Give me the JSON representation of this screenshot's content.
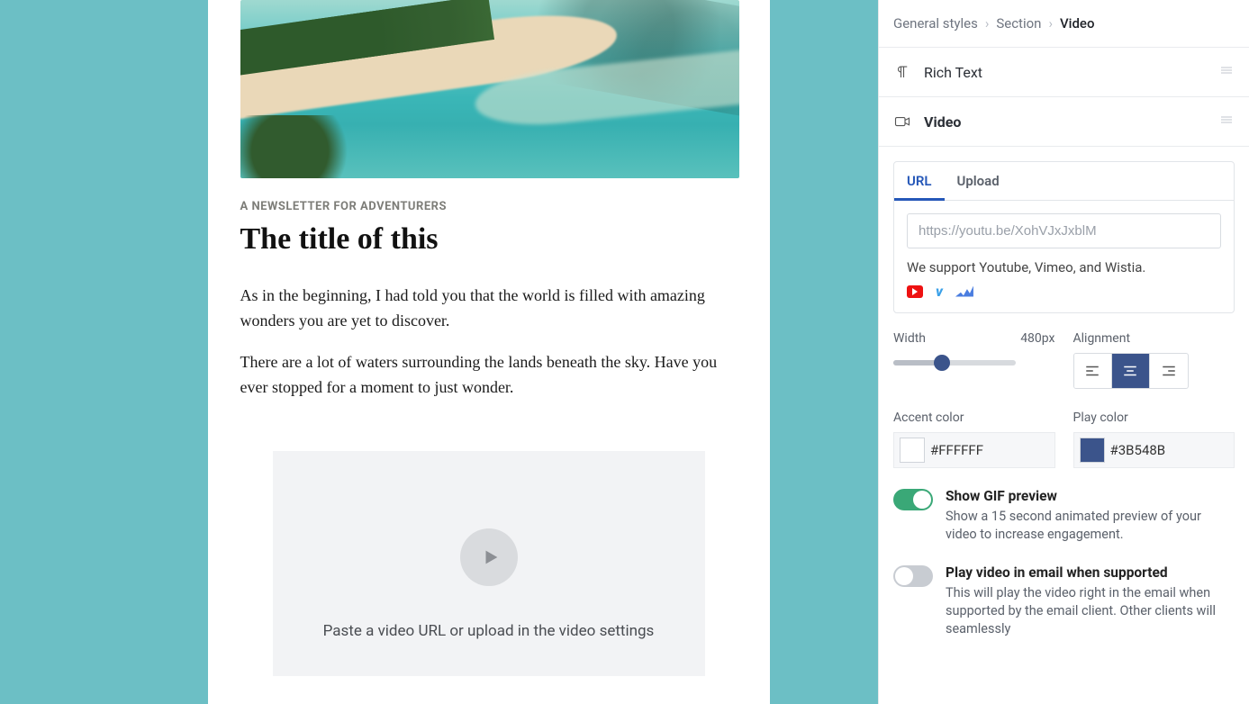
{
  "preview": {
    "kicker": "A NEWSLETTER FOR ADVENTURERS",
    "title": "The title of this",
    "paragraphs": [
      "As in the beginning, I had told you that the world is filled with amazing wonders you are yet to discover.",
      "There are a lot of waters surrounding the lands beneath the sky. Have you ever stopped for a moment to just wonder."
    ],
    "video_placeholder_hint": "Paste a video URL or upload in the video settings"
  },
  "panel": {
    "breadcrumb": {
      "a": "General styles",
      "b": "Section",
      "c": "Video"
    },
    "blocks": {
      "rich_text": "Rich Text",
      "video": "Video"
    },
    "tabs": {
      "url": "URL",
      "upload": "Upload"
    },
    "url_placeholder": "https://youtu.be/XohVJxJxblM",
    "support_text": "We support Youtube, Vimeo, and Wistia.",
    "width_label": "Width",
    "width_value": "480px",
    "alignment_label": "Alignment",
    "alignment_selected": "center",
    "accent_color_label": "Accent color",
    "accent_color_value": "#FFFFFF",
    "play_color_label": "Play color",
    "play_color_value": "#3B548B",
    "toggles": {
      "gif": {
        "on": true,
        "title": "Show GIF preview",
        "desc": "Show a 15 second animated preview of your video to increase engagement."
      },
      "play_in_email": {
        "on": false,
        "title": "Play video in email when supported",
        "desc": "This will play the video right in the email when supported by the email client. Other clients will seamlessly"
      }
    }
  }
}
